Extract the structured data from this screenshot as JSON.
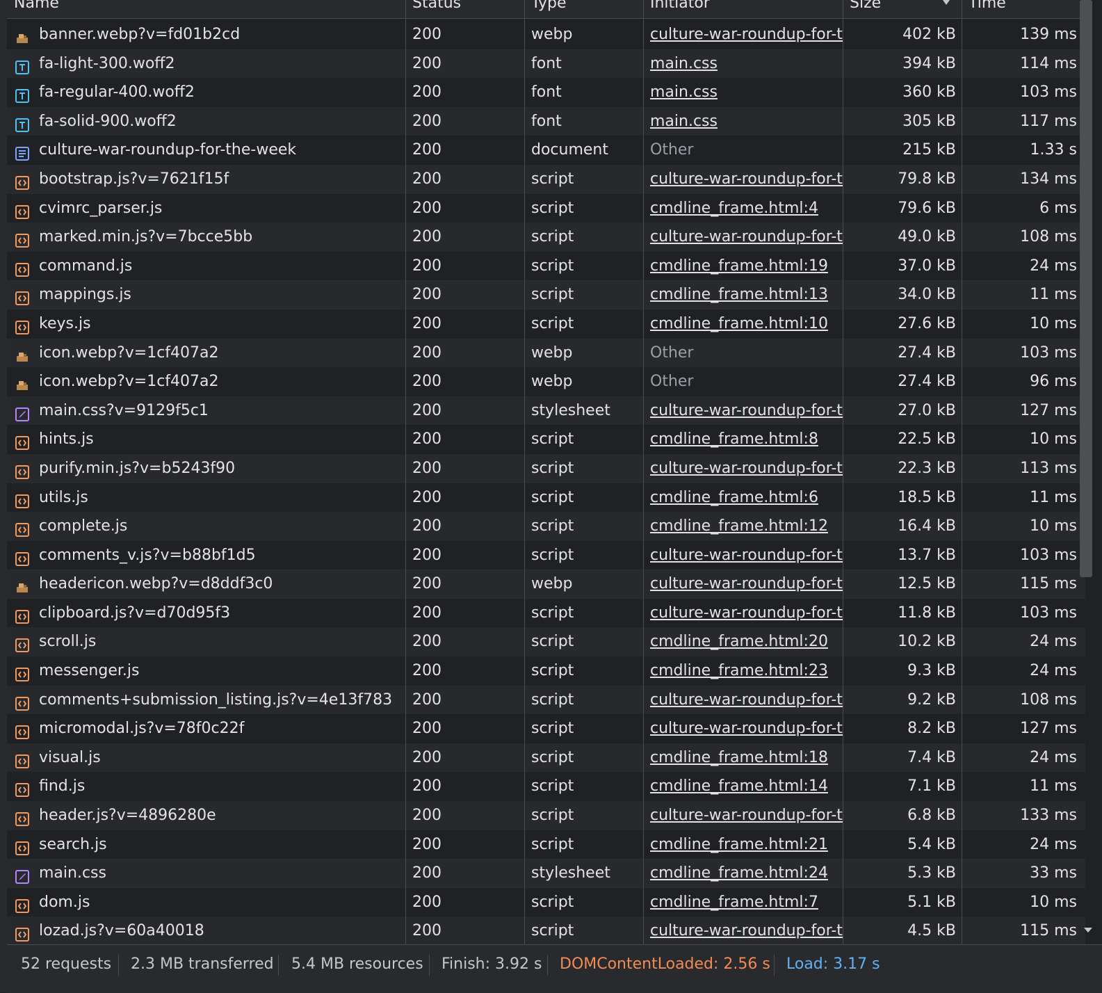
{
  "columns": {
    "name": "Name",
    "status": "Status",
    "type": "Type",
    "initiator": "Initiator",
    "size": "Size",
    "time": "Time"
  },
  "colors": {
    "script": "#f29b61",
    "font": "#4fc3f7",
    "document": "#7aa6ff",
    "stylesheet": "#b388ff",
    "dcl": "#f28b54",
    "load": "#62b0f5"
  },
  "rows": [
    {
      "name": "banner.webp?v=fd01b2cd",
      "icon": "image-icon",
      "status": "200",
      "type": "webp",
      "initiator": "culture-war-roundup-for-t",
      "initiator_kind": "link",
      "size": "402 kB",
      "time": "139 ms"
    },
    {
      "name": "fa-light-300.woff2",
      "icon": "font-icon",
      "status": "200",
      "type": "font",
      "initiator": "main.css",
      "initiator_kind": "link",
      "size": "394 kB",
      "time": "114 ms"
    },
    {
      "name": "fa-regular-400.woff2",
      "icon": "font-icon",
      "status": "200",
      "type": "font",
      "initiator": "main.css",
      "initiator_kind": "link",
      "size": "360 kB",
      "time": "103 ms"
    },
    {
      "name": "fa-solid-900.woff2",
      "icon": "font-icon",
      "status": "200",
      "type": "font",
      "initiator": "main.css",
      "initiator_kind": "link",
      "size": "305 kB",
      "time": "117 ms"
    },
    {
      "name": "culture-war-roundup-for-the-week",
      "icon": "document-icon",
      "status": "200",
      "type": "document",
      "initiator": "Other",
      "initiator_kind": "other",
      "size": "215 kB",
      "time": "1.33 s"
    },
    {
      "name": "bootstrap.js?v=7621f15f",
      "icon": "script-icon",
      "status": "200",
      "type": "script",
      "initiator": "culture-war-roundup-for-t",
      "initiator_kind": "link",
      "size": "79.8 kB",
      "time": "134 ms"
    },
    {
      "name": "cvimrc_parser.js",
      "icon": "script-icon",
      "status": "200",
      "type": "script",
      "initiator": "cmdline_frame.html:4",
      "initiator_kind": "link",
      "size": "79.6 kB",
      "time": "6 ms"
    },
    {
      "name": "marked.min.js?v=7bcce5bb",
      "icon": "script-icon",
      "status": "200",
      "type": "script",
      "initiator": "culture-war-roundup-for-t",
      "initiator_kind": "link",
      "size": "49.0 kB",
      "time": "108 ms"
    },
    {
      "name": "command.js",
      "icon": "script-icon",
      "status": "200",
      "type": "script",
      "initiator": "cmdline_frame.html:19",
      "initiator_kind": "link",
      "size": "37.0 kB",
      "time": "24 ms"
    },
    {
      "name": "mappings.js",
      "icon": "script-icon",
      "status": "200",
      "type": "script",
      "initiator": "cmdline_frame.html:13",
      "initiator_kind": "link",
      "size": "34.0 kB",
      "time": "11 ms"
    },
    {
      "name": "keys.js",
      "icon": "script-icon",
      "status": "200",
      "type": "script",
      "initiator": "cmdline_frame.html:10",
      "initiator_kind": "link",
      "size": "27.6 kB",
      "time": "10 ms"
    },
    {
      "name": "icon.webp?v=1cf407a2",
      "icon": "image-icon",
      "status": "200",
      "type": "webp",
      "initiator": "Other",
      "initiator_kind": "other",
      "size": "27.4 kB",
      "time": "103 ms"
    },
    {
      "name": "icon.webp?v=1cf407a2",
      "icon": "image-icon",
      "status": "200",
      "type": "webp",
      "initiator": "Other",
      "initiator_kind": "other",
      "size": "27.4 kB",
      "time": "96 ms"
    },
    {
      "name": "main.css?v=9129f5c1",
      "icon": "stylesheet-icon",
      "status": "200",
      "type": "stylesheet",
      "initiator": "culture-war-roundup-for-t",
      "initiator_kind": "link",
      "size": "27.0 kB",
      "time": "127 ms"
    },
    {
      "name": "hints.js",
      "icon": "script-icon",
      "status": "200",
      "type": "script",
      "initiator": "cmdline_frame.html:8",
      "initiator_kind": "link",
      "size": "22.5 kB",
      "time": "10 ms"
    },
    {
      "name": "purify.min.js?v=b5243f90",
      "icon": "script-icon",
      "status": "200",
      "type": "script",
      "initiator": "culture-war-roundup-for-t",
      "initiator_kind": "link",
      "size": "22.3 kB",
      "time": "113 ms"
    },
    {
      "name": "utils.js",
      "icon": "script-icon",
      "status": "200",
      "type": "script",
      "initiator": "cmdline_frame.html:6",
      "initiator_kind": "link",
      "size": "18.5 kB",
      "time": "11 ms"
    },
    {
      "name": "complete.js",
      "icon": "script-icon",
      "status": "200",
      "type": "script",
      "initiator": "cmdline_frame.html:12",
      "initiator_kind": "link",
      "size": "16.4 kB",
      "time": "10 ms"
    },
    {
      "name": "comments_v.js?v=b88bf1d5",
      "icon": "script-icon",
      "status": "200",
      "type": "script",
      "initiator": "culture-war-roundup-for-t",
      "initiator_kind": "link",
      "size": "13.7 kB",
      "time": "103 ms"
    },
    {
      "name": "headericon.webp?v=d8ddf3c0",
      "icon": "image-icon",
      "status": "200",
      "type": "webp",
      "initiator": "culture-war-roundup-for-t",
      "initiator_kind": "link",
      "size": "12.5 kB",
      "time": "115 ms"
    },
    {
      "name": "clipboard.js?v=d70d95f3",
      "icon": "script-icon",
      "status": "200",
      "type": "script",
      "initiator": "culture-war-roundup-for-t",
      "initiator_kind": "link",
      "size": "11.8 kB",
      "time": "103 ms"
    },
    {
      "name": "scroll.js",
      "icon": "script-icon",
      "status": "200",
      "type": "script",
      "initiator": "cmdline_frame.html:20",
      "initiator_kind": "link",
      "size": "10.2 kB",
      "time": "24 ms"
    },
    {
      "name": "messenger.js",
      "icon": "script-icon",
      "status": "200",
      "type": "script",
      "initiator": "cmdline_frame.html:23",
      "initiator_kind": "link",
      "size": "9.3 kB",
      "time": "24 ms"
    },
    {
      "name": "comments+submission_listing.js?v=4e13f783",
      "icon": "script-icon",
      "status": "200",
      "type": "script",
      "initiator": "culture-war-roundup-for-t",
      "initiator_kind": "link",
      "size": "9.2 kB",
      "time": "108 ms"
    },
    {
      "name": "micromodal.js?v=78f0c22f",
      "icon": "script-icon",
      "status": "200",
      "type": "script",
      "initiator": "culture-war-roundup-for-t",
      "initiator_kind": "link",
      "size": "8.2 kB",
      "time": "127 ms"
    },
    {
      "name": "visual.js",
      "icon": "script-icon",
      "status": "200",
      "type": "script",
      "initiator": "cmdline_frame.html:18",
      "initiator_kind": "link",
      "size": "7.4 kB",
      "time": "24 ms"
    },
    {
      "name": "find.js",
      "icon": "script-icon",
      "status": "200",
      "type": "script",
      "initiator": "cmdline_frame.html:14",
      "initiator_kind": "link",
      "size": "7.1 kB",
      "time": "11 ms"
    },
    {
      "name": "header.js?v=4896280e",
      "icon": "script-icon",
      "status": "200",
      "type": "script",
      "initiator": "culture-war-roundup-for-t",
      "initiator_kind": "link",
      "size": "6.8 kB",
      "time": "133 ms"
    },
    {
      "name": "search.js",
      "icon": "script-icon",
      "status": "200",
      "type": "script",
      "initiator": "cmdline_frame.html:21",
      "initiator_kind": "link",
      "size": "5.4 kB",
      "time": "24 ms"
    },
    {
      "name": "main.css",
      "icon": "stylesheet-icon",
      "status": "200",
      "type": "stylesheet",
      "initiator": "cmdline_frame.html:24",
      "initiator_kind": "link",
      "size": "5.3 kB",
      "time": "33 ms"
    },
    {
      "name": "dom.js",
      "icon": "script-icon",
      "status": "200",
      "type": "script",
      "initiator": "cmdline_frame.html:7",
      "initiator_kind": "link",
      "size": "5.1 kB",
      "time": "10 ms"
    },
    {
      "name": "lozad.js?v=60a40018",
      "icon": "script-icon",
      "status": "200",
      "type": "script",
      "initiator": "culture-war-roundup-for-t",
      "initiator_kind": "link",
      "size": "4.5 kB",
      "time": "115 ms"
    }
  ],
  "status_bar": {
    "requests": "52 requests",
    "transferred": "2.3 MB transferred",
    "resources": "5.4 MB resources",
    "finish": "Finish: 3.92 s",
    "dom_content_loaded": "DOMContentLoaded: 2.56 s",
    "load": "Load: 3.17 s"
  }
}
